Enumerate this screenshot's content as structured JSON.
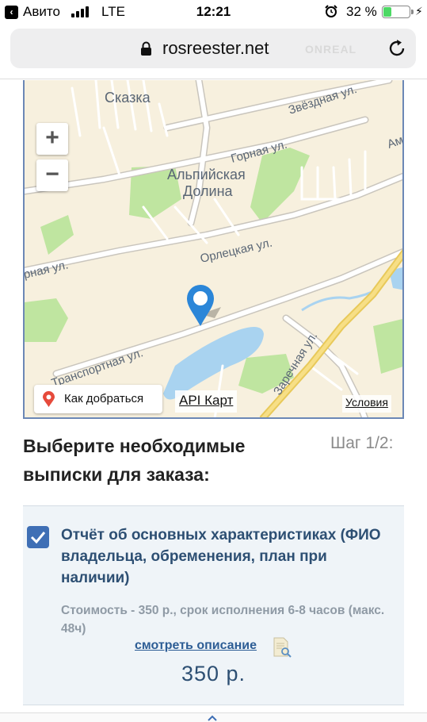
{
  "status_bar": {
    "back_app": "Авито",
    "network": "LTE",
    "time": "12:21",
    "battery_percent": "32 %",
    "battery_level": 0.32
  },
  "browser": {
    "url": "rosreester.net",
    "watermark": "ONREAL"
  },
  "map": {
    "labels": {
      "skazka": "Сказка",
      "zvezdnaya": "Звёздная ул.",
      "gornaya": "Горная ул.",
      "am": "Ам",
      "alpine_1": "Альпийская",
      "alpine_2": "Долина",
      "orletskaya": "Орлецкая ул.",
      "rnaya": "рная ул.",
      "transportnaya": "Транспортная ул.",
      "zarechnaya": "Заречная ул."
    },
    "zoom_in": "+",
    "zoom_out": "−",
    "route_button": "Как добраться",
    "api_link": "API Карт",
    "terms_link": "Условия"
  },
  "order": {
    "heading": "Выберите необходимые выписки для заказа:",
    "step": "Шаг 1/2:",
    "item": {
      "checked": true,
      "title": "Отчёт об основных характеристиках (ФИО владельца, обременения, план при наличии)",
      "info": "Стоимость - 350 р., срок исполнения 6-8 часов (макс. 48ч)",
      "description_link": "смотреть описание",
      "price": "350 р."
    }
  },
  "colors": {
    "accent": "#3f6fb5",
    "title_text": "#2d4f73",
    "map_park": "#bfe5a0",
    "map_water": "#a9d3f0",
    "map_pin": "#2b86d8",
    "route_pin": "#e64a3b"
  }
}
